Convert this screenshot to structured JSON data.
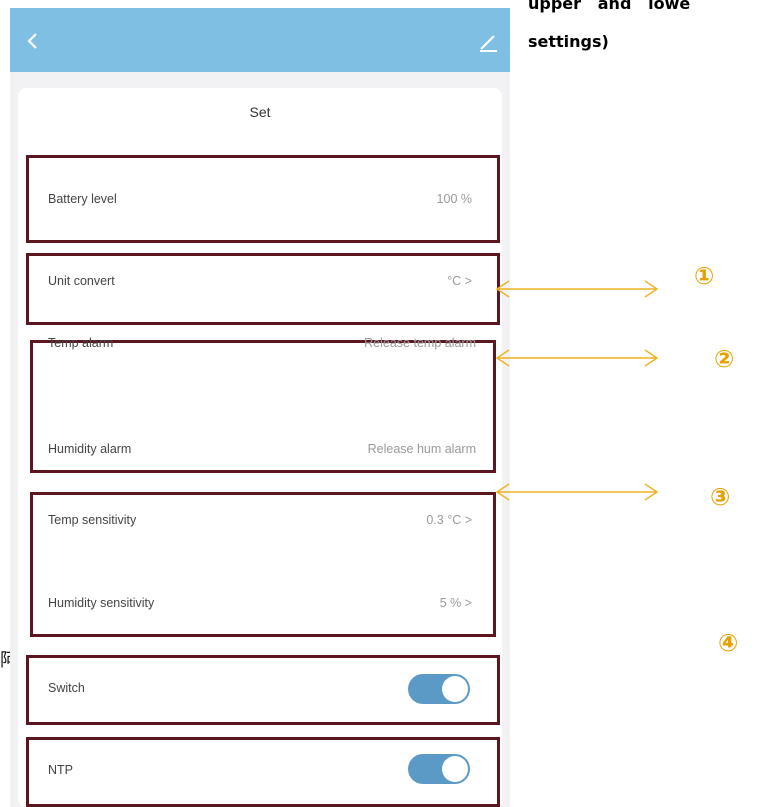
{
  "annotation": {
    "line1": "upper   and   lowe",
    "line2": "settings)",
    "margin_char": "阿"
  },
  "header": {
    "title": "Set",
    "back_icon": "chevron-left-icon",
    "edit_icon": "pencil-icon",
    "bar_color": "#7fbfe4"
  },
  "rows": {
    "battery": {
      "label": "Battery level",
      "value": "100 %"
    },
    "unit": {
      "label": "Unit convert",
      "value": "°C  >"
    },
    "temp_alarm": {
      "label": "Temp alarm",
      "value": "Release temp alarm"
    },
    "hum_alarm": {
      "label": "Humidity alarm",
      "value": "Release hum alarm"
    },
    "temp_sens": {
      "label": "Temp sensitivity",
      "value": "0.3 °C  >"
    },
    "hum_sens": {
      "label": "Humidity sensitivity",
      "value": "5 %  >"
    },
    "switch": {
      "label": "Switch",
      "on": true
    },
    "ntp": {
      "label": "NTP",
      "on": true
    }
  },
  "markers": [
    "①",
    "②",
    "③",
    "④"
  ],
  "colors": {
    "highlight_border": "#5c1620",
    "arrow": "#f0b020",
    "toggle_on": "#5b9ac6"
  }
}
